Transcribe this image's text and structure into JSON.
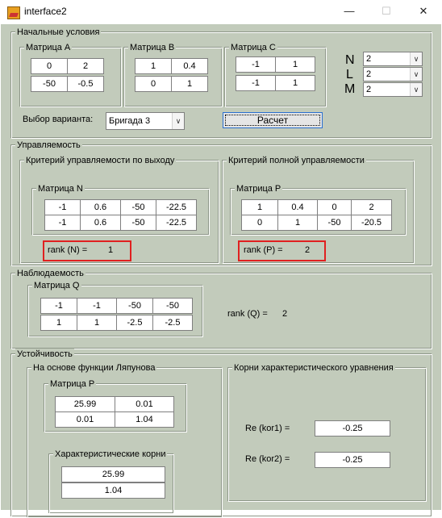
{
  "window": {
    "title": "interface2",
    "minimize": "—",
    "maximize": "☐",
    "close": "✕"
  },
  "initial": {
    "title": "Начальные условия",
    "A": {
      "title": "Матрица A",
      "cells": [
        "0",
        "2",
        "-50",
        "-0.5"
      ]
    },
    "B": {
      "title": "Матрица B",
      "cells": [
        "1",
        "0.4",
        "0",
        "1"
      ]
    },
    "C": {
      "title": "Матрица C",
      "cells": [
        "-1",
        "1",
        "-1",
        "1"
      ]
    },
    "NLM": {
      "labels": [
        "N",
        "L",
        "M"
      ],
      "values": [
        "2",
        "2",
        "2"
      ]
    },
    "variant_label": "Выбор варианта:",
    "variant_value": "Бригада 3",
    "calc_button": "Расчет"
  },
  "control": {
    "title": "Управляемость",
    "output": {
      "title": "Критерий  управляемости по выходу",
      "matrix_title": "Матрица N",
      "cells": [
        "-1",
        "0.6",
        "-50",
        "-22.5",
        "-1",
        "0.6",
        "-50",
        "-22.5"
      ],
      "rank_label": "rank (N) =",
      "rank_value": "1"
    },
    "full": {
      "title": "Критерий полной  управляемости",
      "matrix_title": "Матрица P",
      "cells": [
        "1",
        "0.4",
        "0",
        "2",
        "0",
        "1",
        "-50",
        "-20.5"
      ],
      "rank_label": "rank (P) =",
      "rank_value": "2"
    }
  },
  "observe": {
    "title": "Наблюдаемость",
    "matrix_title": "Матрица Q",
    "cells": [
      "-1",
      "-1",
      "-50",
      "-50",
      "1",
      "1",
      "-2.5",
      "-2.5"
    ],
    "rank_label": "rank (Q) =",
    "rank_value": "2"
  },
  "stability": {
    "title": "Устойчивость",
    "lyapunov": {
      "title": "На основе функции Ляпунова",
      "matrix_title": "Матрица P",
      "cells": [
        "25.99",
        "0.01",
        "0.01",
        "1.04"
      ],
      "roots_title": "Характеристические корни",
      "roots": [
        "25.99",
        "1.04"
      ]
    },
    "char_eq": {
      "title": "Корни характеристического уравнения",
      "kor1_label": "Re (kor1) =",
      "kor1_value": "-0.25",
      "kor2_label": "Re (kor2) =",
      "kor2_value": "-0.25"
    }
  },
  "colors": {
    "panel_bg": "#c2cbbb",
    "highlight": "#e02020",
    "button_border": "#2a6fd0"
  }
}
